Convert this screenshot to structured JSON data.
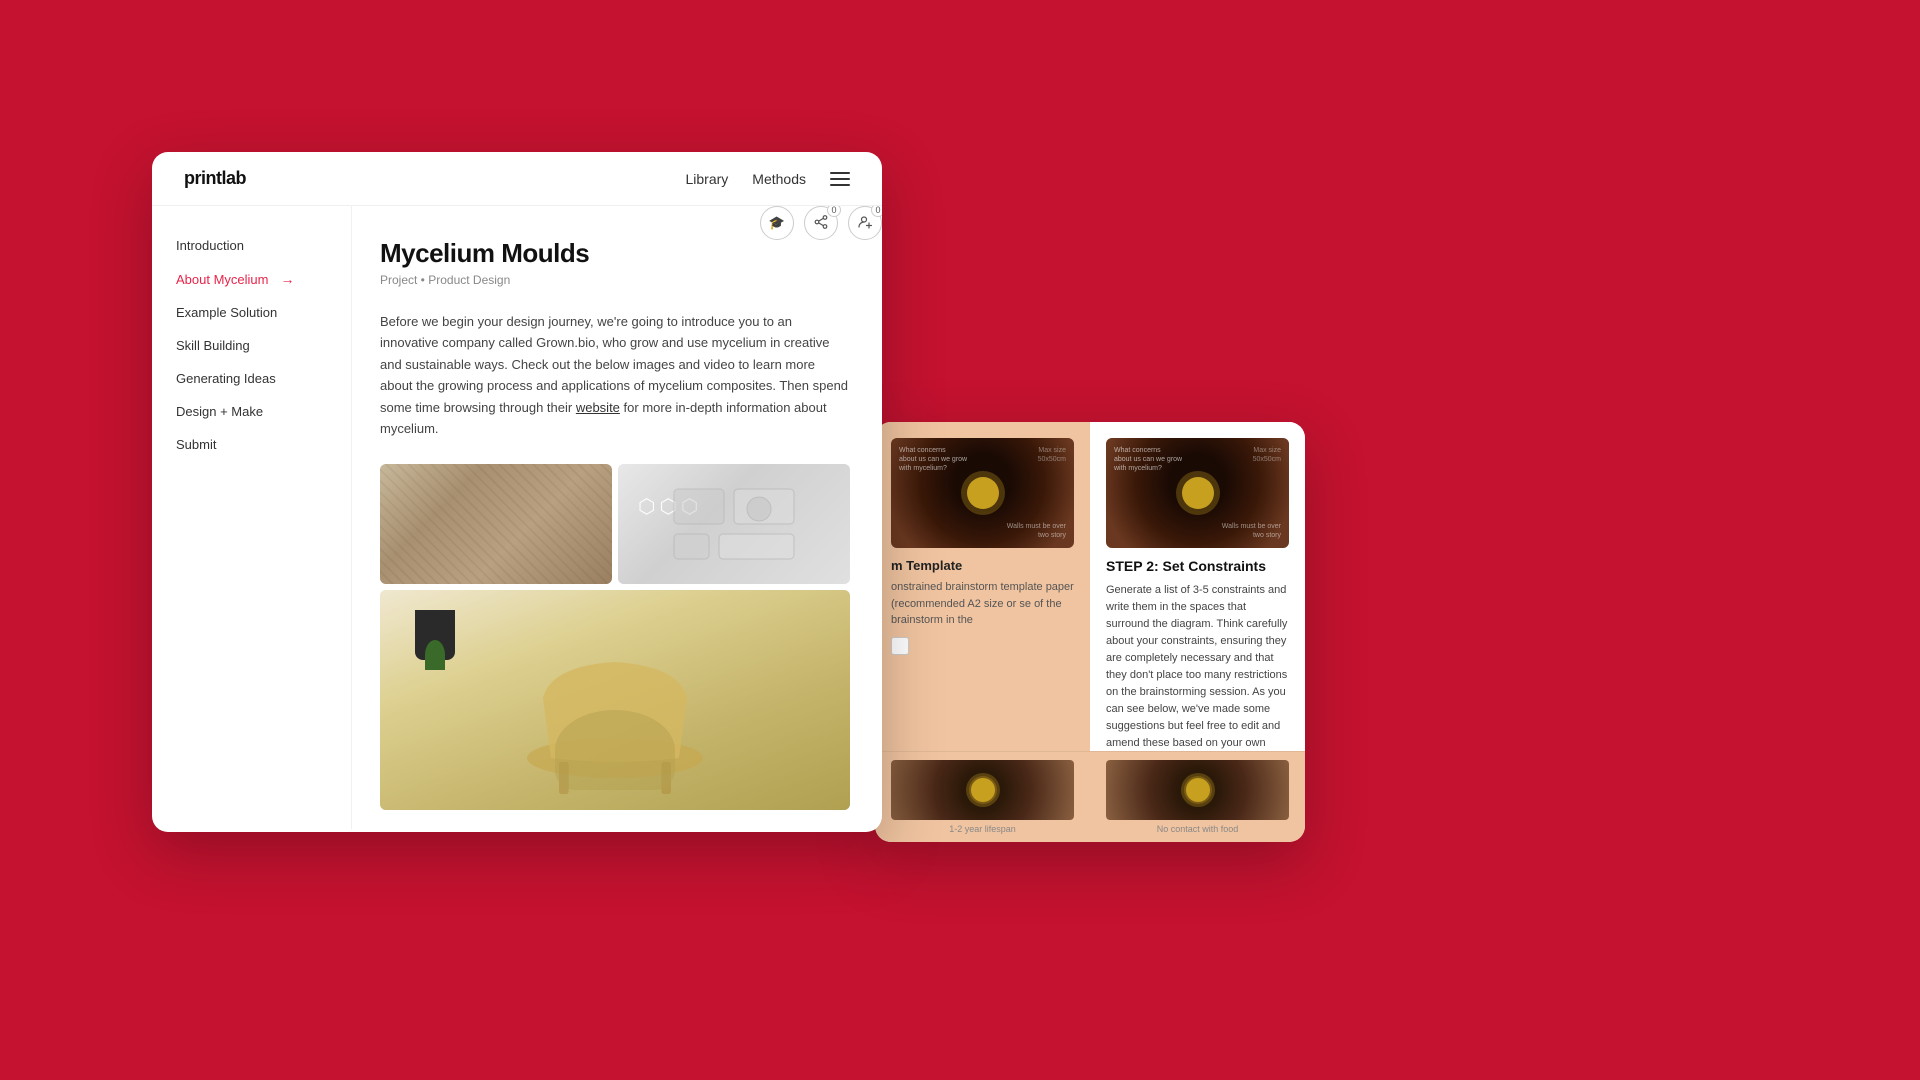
{
  "background": {
    "color": "#c41230"
  },
  "main_window": {
    "nav": {
      "logo": "printlab",
      "links": [
        {
          "label": "Library",
          "id": "library"
        },
        {
          "label": "Methods",
          "id": "methods"
        }
      ],
      "menu_icon": "hamburger-menu"
    },
    "page_header": {
      "title": "Mycelium Moulds",
      "meta": "Project • Product Design"
    },
    "actions": [
      {
        "icon": "graduation-cap",
        "badge": null
      },
      {
        "icon": "share",
        "badge": "0"
      },
      {
        "icon": "person-add",
        "badge": "0"
      }
    ],
    "sidebar": {
      "items": [
        {
          "label": "Introduction",
          "active": false
        },
        {
          "label": "About Mycelium",
          "active": true
        },
        {
          "label": "Example Solution",
          "active": false
        },
        {
          "label": "Skill Building",
          "active": false
        },
        {
          "label": "Generating Ideas",
          "active": false
        },
        {
          "label": "Design + Make",
          "active": false
        },
        {
          "label": "Submit",
          "active": false
        }
      ]
    },
    "intro_text": {
      "paragraph": "Before we begin your design journey, we're going to introduce you to an innovative company called Grown.bio, who grow and use mycelium in creative and sustainable ways. Check out the below images and video to learn more about the growing process and applications of mycelium composites. Then spend some time browsing through their",
      "link_text": "website",
      "paragraph_end": "for more in-depth information about mycelium."
    },
    "images": [
      {
        "alt": "Mycelium wall texture",
        "type": "wall"
      },
      {
        "alt": "Mycelium molds",
        "type": "molds"
      },
      {
        "alt": "Mycelium chair",
        "type": "chair"
      }
    ]
  },
  "secondary_window": {
    "cards": [
      {
        "title": "m Template",
        "text": "onstrained brainstorm template paper (recommended A2 size or se of the brainstorm in the",
        "img_type": "dark-radial"
      },
      {
        "title": "STEP 2: Set Constraints",
        "text": "Generate a list of 3-5 constraints and write them in the spaces that surround the diagram. Think carefully about your constraints, ensuring they are completely necessary and that they don't place too many restrictions on the brainstorming session. As you can see below, we've made some suggestions but feel free to edit and amend these based on your own research.",
        "img_type": "dark-radial-2"
      }
    ],
    "bottom_cards": [
      {
        "label": "1-2 year lifespan",
        "img_type": "dark-radial"
      },
      {
        "label": "No contact with food",
        "img_type": "dark-radial"
      }
    ]
  }
}
